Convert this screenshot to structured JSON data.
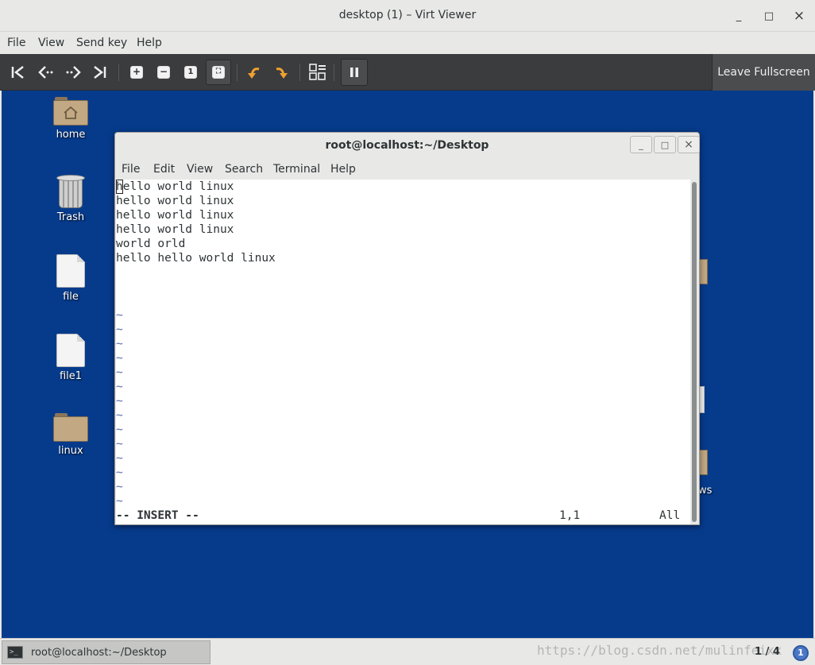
{
  "window": {
    "title": "desktop (1) – Virt Viewer",
    "controls": {
      "minimize": "_",
      "maximize": "□",
      "close": "×"
    }
  },
  "menubar": [
    "File",
    "View",
    "Send key",
    "Help"
  ],
  "toolbar": {
    "leave_fullscreen": "Leave Fullscreen",
    "buttons": [
      "first-icon",
      "back-icon",
      "forward-icon",
      "last-icon",
      "zoom-in-icon",
      "zoom-out-icon",
      "zoom-reset-icon",
      "fit-screen-icon",
      "undo-icon",
      "redo-icon",
      "grid-icon",
      "pause-icon"
    ]
  },
  "desktop": {
    "background": "#063b8c",
    "icons": [
      {
        "label": "home"
      },
      {
        "label": "Trash"
      },
      {
        "label": "file"
      },
      {
        "label": "file1"
      },
      {
        "label": "linux"
      }
    ],
    "partial_label": "ws"
  },
  "terminal": {
    "title": "root@localhost:~/Desktop",
    "menu": [
      "File",
      "Edit",
      "View",
      "Search",
      "Terminal",
      "Help"
    ],
    "lines": [
      "hello world linux",
      "hello world linux",
      "hello world linux",
      "hello world linux",
      "world orld",
      "hello hello world linux"
    ],
    "tilde": "~",
    "status": {
      "mode": "-- INSERT --",
      "position": "1,1",
      "scope": "All"
    }
  },
  "taskbar": {
    "item": "root@localhost:~/Desktop",
    "workspace": "1 / 4",
    "notification": "1",
    "watermark": "https://blog.csdn.net/mulinfeixx"
  }
}
